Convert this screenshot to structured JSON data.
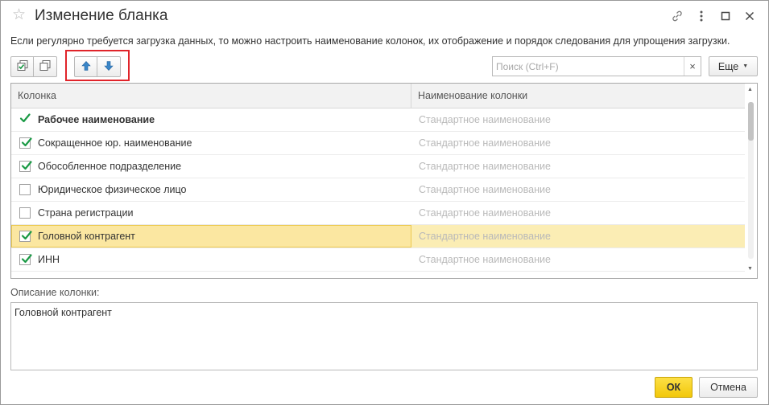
{
  "window": {
    "title": "Изменение бланка",
    "favorite_icon": "star-icon",
    "title_icons": [
      "link-icon",
      "more-vertical-icon",
      "maximize-icon",
      "close-icon"
    ]
  },
  "hint": "Если регулярно требуется загрузка данных, то можно настроить наименование колонок, их отображение и порядок следования для упрощения загрузки.",
  "toolbar": {
    "check_all_icon": "check-all-icon",
    "uncheck_all_icon": "uncheck-all-icon",
    "move_up_icon": "arrow-up-icon",
    "move_down_icon": "arrow-down-icon",
    "search_placeholder": "Поиск (Ctrl+F)",
    "search_clear": "×",
    "more_label": "Еще"
  },
  "table": {
    "columns": [
      "Колонка",
      "Наименование колонки"
    ],
    "rows": [
      {
        "label": "Рабочее наименование",
        "display_name": "Стандартное наименование",
        "checked": true,
        "required": true,
        "selected": false
      },
      {
        "label": "Сокращенное юр. наименование",
        "display_name": "Стандартное наименование",
        "checked": true,
        "required": false,
        "selected": false
      },
      {
        "label": "Обособленное подразделение",
        "display_name": "Стандартное наименование",
        "checked": true,
        "required": false,
        "selected": false
      },
      {
        "label": "Юридическое физическое лицо",
        "display_name": "Стандартное наименование",
        "checked": false,
        "required": false,
        "selected": false
      },
      {
        "label": "Страна регистрации",
        "display_name": "Стандартное наименование",
        "checked": false,
        "required": false,
        "selected": false
      },
      {
        "label": "Головной контрагент",
        "display_name": "Стандартное наименование",
        "checked": true,
        "required": false,
        "selected": true
      },
      {
        "label": "ИНН",
        "display_name": "Стандартное наименование",
        "checked": true,
        "required": false,
        "selected": false
      }
    ]
  },
  "description": {
    "label": "Описание колонки:",
    "value": "Головной контрагент"
  },
  "footer": {
    "ok_label": "ОК",
    "cancel_label": "Отмена"
  },
  "colors": {
    "ok_button": "#f5cf1c",
    "selection": "#fbedb4",
    "checkmark": "#1a9a45",
    "move_arrows": "#3a86c8",
    "highlight_frame": "#e0242a"
  }
}
